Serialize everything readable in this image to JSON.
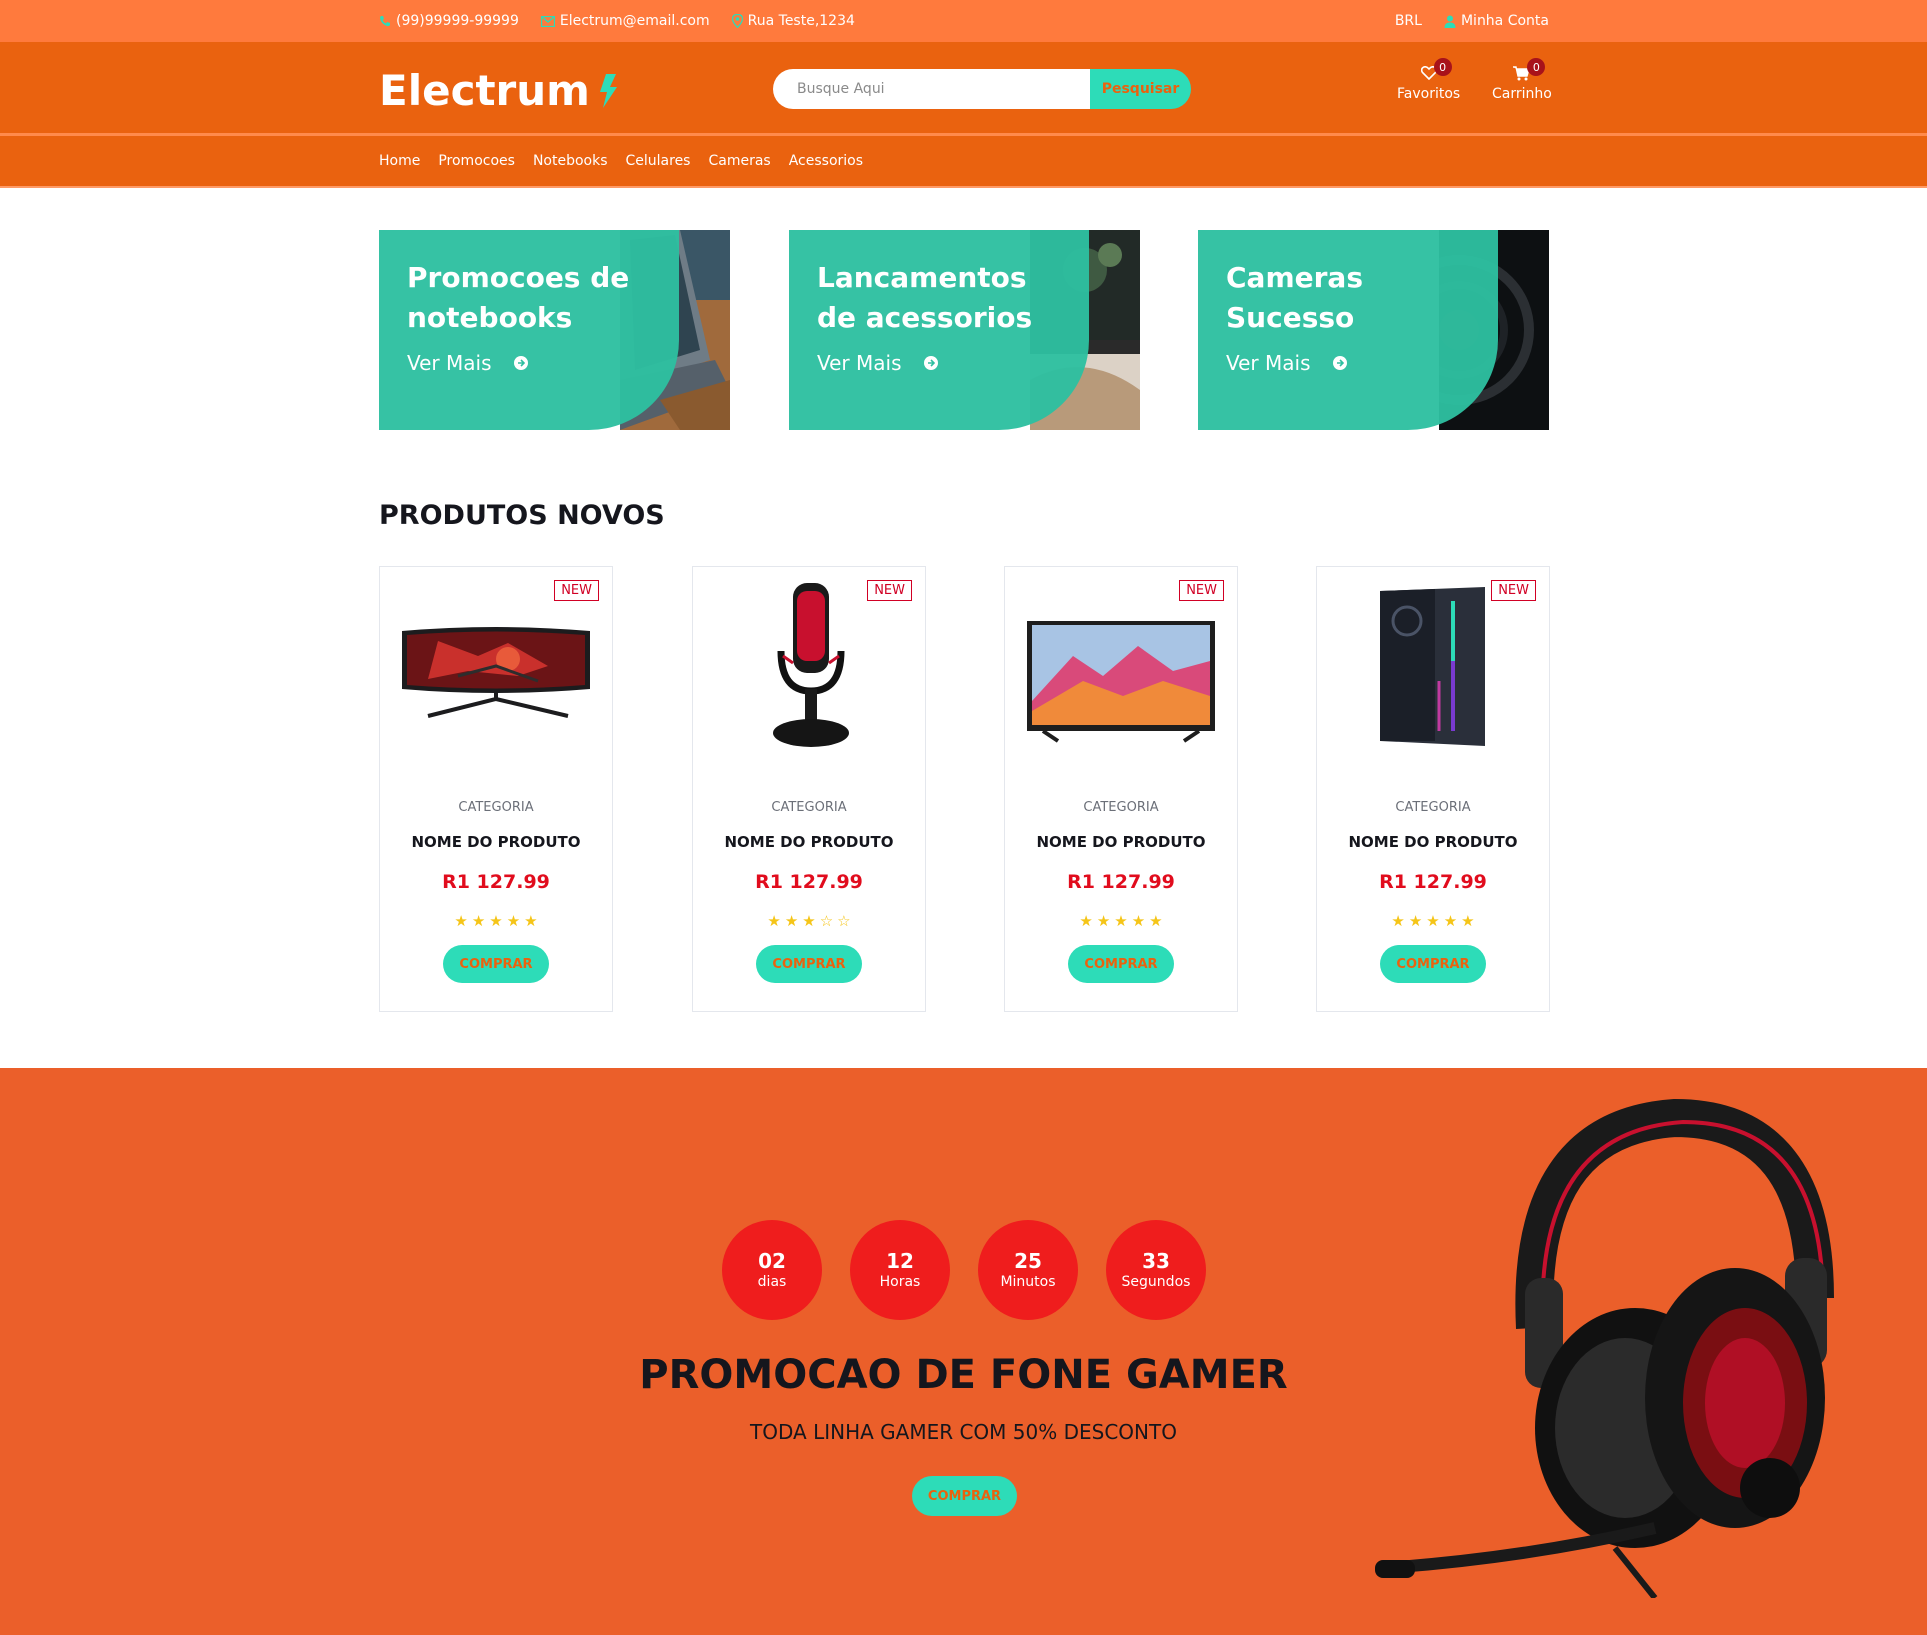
{
  "topbar": {
    "phone": "(99)99999-99999",
    "email": "Electrum@email.com",
    "address": "Rua Teste,1234",
    "currency": "BRL",
    "account": "Minha Conta"
  },
  "header": {
    "logo": "Electrum",
    "search_placeholder": "Busque Aqui",
    "search_button": "Pesquisar",
    "favorites_label": "Favoritos",
    "favorites_count": "0",
    "cart_label": "Carrinho",
    "cart_count": "0"
  },
  "nav": {
    "items": [
      "Home",
      "Promocoes",
      "Notebooks",
      "Celulares",
      "Cameras",
      "Acessorios"
    ]
  },
  "banners": [
    {
      "title": "Promocoes de notebooks",
      "link": "Ver Mais"
    },
    {
      "title": "Lancamentos de acessorios",
      "link": "Ver Mais"
    },
    {
      "title": "Cameras Sucesso",
      "link": "Ver Mais"
    }
  ],
  "products_section": {
    "title": "PRODUTOS NOVOS",
    "items": [
      {
        "badge": "NEW",
        "category": "CATEGORIA",
        "name": "NOME DO PRODUTO",
        "price": "R1 127.99",
        "rating": 5,
        "button": "COMPRAR",
        "image": "monitor"
      },
      {
        "badge": "NEW",
        "category": "CATEGORIA",
        "name": "NOME DO PRODUTO",
        "price": "R1 127.99",
        "rating": 3,
        "button": "COMPRAR",
        "image": "microphone"
      },
      {
        "badge": "NEW",
        "category": "CATEGORIA",
        "name": "NOME DO PRODUTO",
        "price": "R1 127.99",
        "rating": 5,
        "button": "COMPRAR",
        "image": "tv"
      },
      {
        "badge": "NEW",
        "category": "CATEGORIA",
        "name": "NOME DO PRODUTO",
        "price": "R1 127.99",
        "rating": 5,
        "button": "COMPRAR",
        "image": "pc-case"
      }
    ]
  },
  "promo": {
    "countdown": [
      {
        "value": "02",
        "unit": "dias"
      },
      {
        "value": "12",
        "unit": "Horas"
      },
      {
        "value": "25",
        "unit": "Minutos"
      },
      {
        "value": "33",
        "unit": "Segundos"
      }
    ],
    "title": "PROMOCAO DE FONE GAMER",
    "subtitle": "TODA LINHA GAMER COM 50% DESCONTO",
    "button": "COMPRAR"
  },
  "colors": {
    "accent": "#2ddcb8",
    "header": "#ea620f",
    "topbar": "#ff7a3d",
    "promo": "#eb5f2a",
    "price": "#e10c1d"
  }
}
